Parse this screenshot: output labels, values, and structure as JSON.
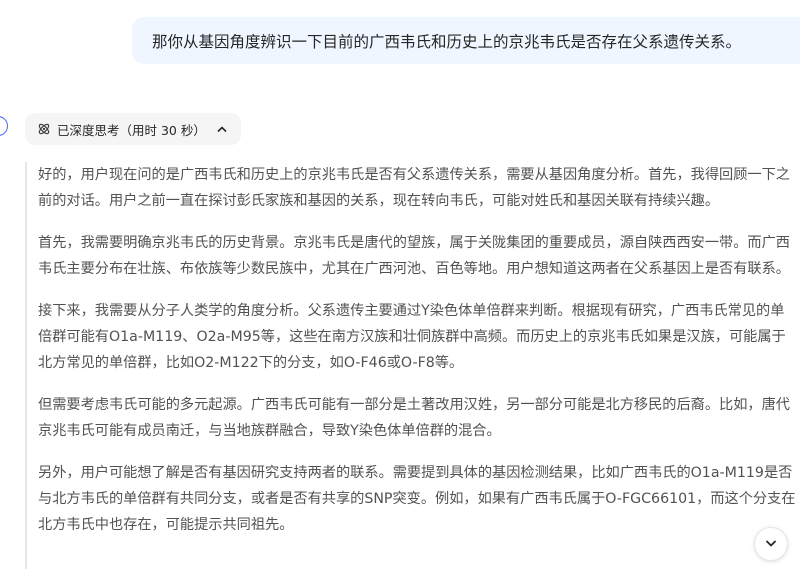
{
  "user_message": "那你从基因角度辨识一下目前的广西韦氏和历史上的京兆韦氏是否存在父系遗传关系。",
  "thinking": {
    "status_label": "已深度思考（用时 30 秒）",
    "icon": "atom-icon",
    "toggle_icon": "chevron-up-icon",
    "paragraphs": [
      "好的，用户现在问的是广西韦氏和历史上的京兆韦氏是否有父系遗传关系，需要从基因角度分析。首先，我得回顾一下之前的对话。用户之前一直在探讨彭氏家族和基因的关系，现在转向韦氏，可能对姓氏和基因关联有持续兴趣。",
      "首先，我需要明确京兆韦氏的历史背景。京兆韦氏是唐代的望族，属于关陇集团的重要成员，源自陕西西安一带。而广西韦氏主要分布在壮族、布依族等少数民族中，尤其在广西河池、百色等地。用户想知道这两者在父系基因上是否有联系。",
      "接下来，我需要从分子人类学的角度分析。父系遗传主要通过Y染色体单倍群来判断。根据现有研究，广西韦氏常见的单倍群可能有O1a-M119、O2a-M95等，这些在南方汉族和壮侗族群中高频。而历史上的京兆韦氏如果是汉族，可能属于北方常见的单倍群，比如O2-M122下的分支，如O-F46或O-F8等。",
      "但需要考虑韦氏可能的多元起源。广西韦氏可能有一部分是土著改用汉姓，另一部分可能是北方移民的后裔。比如，唐代京兆韦氏可能有成员南迁，与当地族群融合，导致Y染色体单倍群的混合。",
      "另外，用户可能想了解是否有基因研究支持两者的联系。需要提到具体的基因检测结果，比如广西韦氏的O1a-M119是否与北方韦氏的单倍群有共同分支，或者是否有共享的SNP突变。例如，如果有广西韦氏属于O-FGC66101，而这个分支在北方韦氏中也存在，可能提示共同祖先。"
    ]
  },
  "scroll_button": {
    "icon": "chevron-down-icon"
  }
}
